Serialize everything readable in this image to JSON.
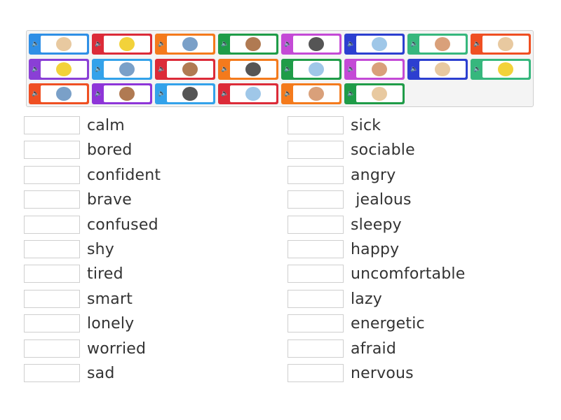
{
  "tiles": [
    {
      "color": "#2f8fe6",
      "icon": "speaker-icon",
      "image": "person-flexing"
    },
    {
      "color": "#dc2b38",
      "icon": "speaker-icon",
      "image": "businessman-confident"
    },
    {
      "color": "#f47a1c",
      "icon": "speaker-icon",
      "image": "person-walking-hall"
    },
    {
      "color": "#1f9c48",
      "icon": "speaker-icon",
      "image": "person-reading"
    },
    {
      "color": "#c44ad6",
      "icon": "speaker-icon",
      "image": "person-worried"
    },
    {
      "color": "#2c3fd0",
      "icon": "speaker-icon",
      "image": "cartoon-sick"
    },
    {
      "color": "#36b77d",
      "icon": "speaker-icon",
      "image": "person-sad"
    },
    {
      "color": "#ef4f22",
      "icon": "speaker-icon",
      "image": "cartoon-confused"
    },
    {
      "color": "#8a3fd6",
      "icon": "speaker-icon",
      "image": "blue-face"
    },
    {
      "color": "#33a2ea",
      "icon": "speaker-icon",
      "image": "woman-smiling"
    },
    {
      "color": "#dc2b38",
      "icon": "speaker-icon",
      "image": "yellow-face"
    },
    {
      "color": "#f47a1c",
      "icon": "speaker-icon",
      "image": "person-meditating"
    },
    {
      "color": "#1f9c48",
      "icon": "speaker-icon",
      "image": "person-alone"
    },
    {
      "color": "#c44ad6",
      "icon": "speaker-icon",
      "image": "person-tired"
    },
    {
      "color": "#2c3fd0",
      "icon": "speaker-icon",
      "image": "crying-face"
    },
    {
      "color": "#36b77d",
      "icon": "speaker-icon",
      "image": "person-smart"
    },
    {
      "color": "#ef4f22",
      "icon": "speaker-icon",
      "image": "people-party"
    },
    {
      "color": "#8e35d8",
      "icon": "speaker-icon",
      "image": "cartoon-lazy"
    },
    {
      "color": "#33a2ea",
      "icon": "speaker-icon",
      "image": "friends-group"
    },
    {
      "color": "#dc2b38",
      "icon": "speaker-icon",
      "image": "cartoon-running"
    },
    {
      "color": "#f47a1c",
      "icon": "speaker-icon",
      "image": "man-speaking"
    },
    {
      "color": "#1f9c48",
      "icon": "speaker-icon",
      "image": "person-sleeping"
    }
  ],
  "left_words": [
    "calm",
    "bored",
    "confident",
    "brave",
    "confused",
    "shy",
    "tired",
    "smart",
    "lonely",
    "worried",
    "sad"
  ],
  "right_words": [
    "sick",
    "sociable",
    "angry",
    " jealous",
    "sleepy",
    "happy",
    "uncomfortable",
    "lazy",
    "energetic",
    "afraid",
    "nervous"
  ]
}
